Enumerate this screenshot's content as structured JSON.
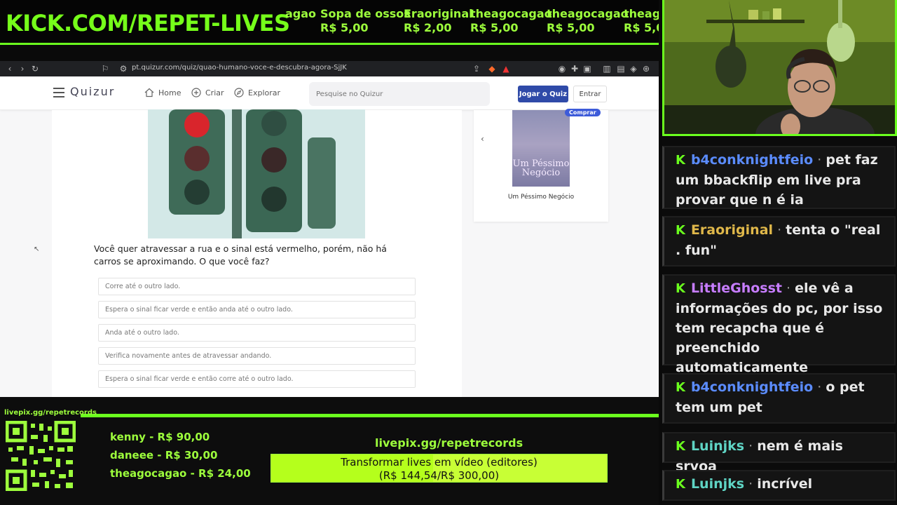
{
  "banner": {
    "url": "KICK.COM/REPET-LIVES",
    "ticker": [
      {
        "name": "agao",
        "value": ""
      },
      {
        "name": "Sopa de ossos",
        "value": "R$ 5,00"
      },
      {
        "name": "Eraoriginal",
        "value": "R$ 2,00"
      },
      {
        "name": "theagocagao",
        "value": "R$ 5,00"
      },
      {
        "name": "theagocagao",
        "value": "R$ 5,00"
      },
      {
        "name": "theago",
        "value": "R$ 5,0"
      }
    ]
  },
  "browser": {
    "address": "pt.quizur.com/quiz/quao-humano-voce-e-descubra-agora-SjJK"
  },
  "quizur": {
    "logo": "Quizur",
    "nav": {
      "home": "Home",
      "create": "Criar",
      "explore": "Explorar"
    },
    "search_placeholder": "Pesquise no Quizur",
    "play_button": "Jogar o Quiz",
    "login_button": "Entrar",
    "question": "Você quer atravessar a rua e o sinal está vermelho, porém, não há carros se aproximando. O que você faz?",
    "options": [
      "Corre até o outro lado.",
      "Espera o sinal ficar verde e então anda até o outro lado.",
      "Anda até o outro lado.",
      "Verifica novamente antes de atravessar andando.",
      "Espera o sinal ficar verde e então corre até o outro lado."
    ],
    "sidebar": {
      "badge": "Comprar",
      "book_cover_title": "Um Péssimo Negócio",
      "book_name": "Um Péssimo Negócio"
    }
  },
  "donations": {
    "livepix_small": "livepix.gg/repetrecords",
    "top_donors": [
      "kenny - R$ 90,00",
      "daneee - R$ 30,00",
      "theagocagao - R$ 24,00"
    ],
    "livepix_main": "livepix.gg/repetrecords",
    "goal_title": "Transformar lives em vídeo (editores)",
    "goal_progress": "(R$ 144,54/R$ 300,00)",
    "goal_fraction": 0.4818
  },
  "chat": [
    {
      "user": "b4conknightfeio",
      "color": "#5b8cff",
      "text": "pet faz um bbackflip em live pra provar que n é ia"
    },
    {
      "user": "Eraoriginal",
      "color": "#e0b84a",
      "text": "tenta o \"real . fun\""
    },
    {
      "user": "LittleGhosst",
      "color": "#c77dff",
      "text": "ele vê a informações do pc, por isso tem recapcha que é preenchido automaticamente"
    },
    {
      "user": "b4conknightfeio",
      "color": "#5b8cff",
      "text": "o pet tem um pet"
    },
    {
      "user": "Luinjks",
      "color": "#5fd4c4",
      "text": "nem é mais srvoa"
    },
    {
      "user": "Luinjks",
      "color": "#5fd4c4",
      "text": "incrível"
    }
  ],
  "colors": {
    "accent": "#6bff1e",
    "primary_button": "#2f4aa8"
  }
}
